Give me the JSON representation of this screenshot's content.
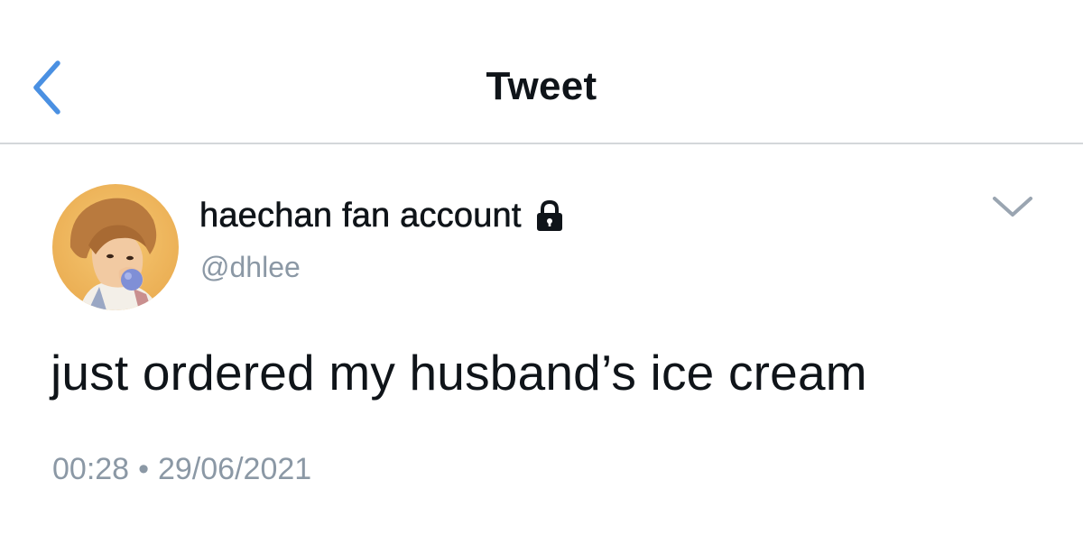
{
  "header": {
    "title": "Tweet",
    "back_icon": "chevron-left-icon"
  },
  "colors": {
    "accent": "#4a90e2",
    "text_primary": "#0f1419",
    "text_secondary": "#8b98a5",
    "divider": "#d4d7da"
  },
  "tweet": {
    "author": {
      "display_name": "haechan fan account",
      "handle": "@dhlee",
      "protected_icon": "lock-icon",
      "avatar": "profile-photo"
    },
    "more_icon": "chevron-down-icon",
    "text": "just ordered my husband’s ice cream",
    "time": "00:28",
    "separator": "•",
    "date": "29/06/2021"
  }
}
